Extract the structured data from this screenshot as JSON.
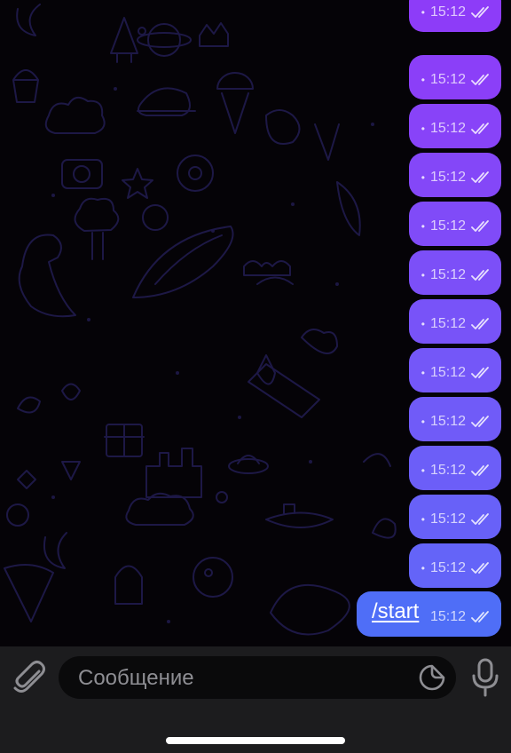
{
  "chat": {
    "messages": [
      {
        "time": "15:12",
        "color": "#8d3cf8"
      },
      {
        "time": "15:12",
        "color": "#8b3ff8"
      },
      {
        "time": "15:12",
        "color": "#8843f8"
      },
      {
        "time": "15:12",
        "color": "#8447f8"
      },
      {
        "time": "15:12",
        "color": "#804bf8"
      },
      {
        "time": "15:12",
        "color": "#7c4ff8"
      },
      {
        "time": "15:12",
        "color": "#7853f8"
      },
      {
        "time": "15:12",
        "color": "#7457f8"
      },
      {
        "time": "15:12",
        "color": "#705bf8"
      },
      {
        "time": "15:12",
        "color": "#6c5ef8"
      },
      {
        "time": "15:12",
        "color": "#6861f8"
      },
      {
        "time": "15:12",
        "color": "#6464f8"
      },
      {
        "time": "15:12",
        "color": "#6067f8"
      },
      {
        "text": "/start",
        "time": "15:12",
        "color": "#4f6ef7"
      }
    ]
  },
  "input_bar": {
    "placeholder": "Сообщение",
    "attach_icon": "paperclip-icon",
    "sticker_icon": "sticker-icon",
    "mic_icon": "microphone-icon"
  },
  "colors": {
    "bubble_top": "#8d3cf8",
    "bubble_bottom": "#4f6ef7",
    "input_bar": "#1c1c1e",
    "input_field": "#0a0a0b",
    "doodle": "#1f1a4a"
  }
}
